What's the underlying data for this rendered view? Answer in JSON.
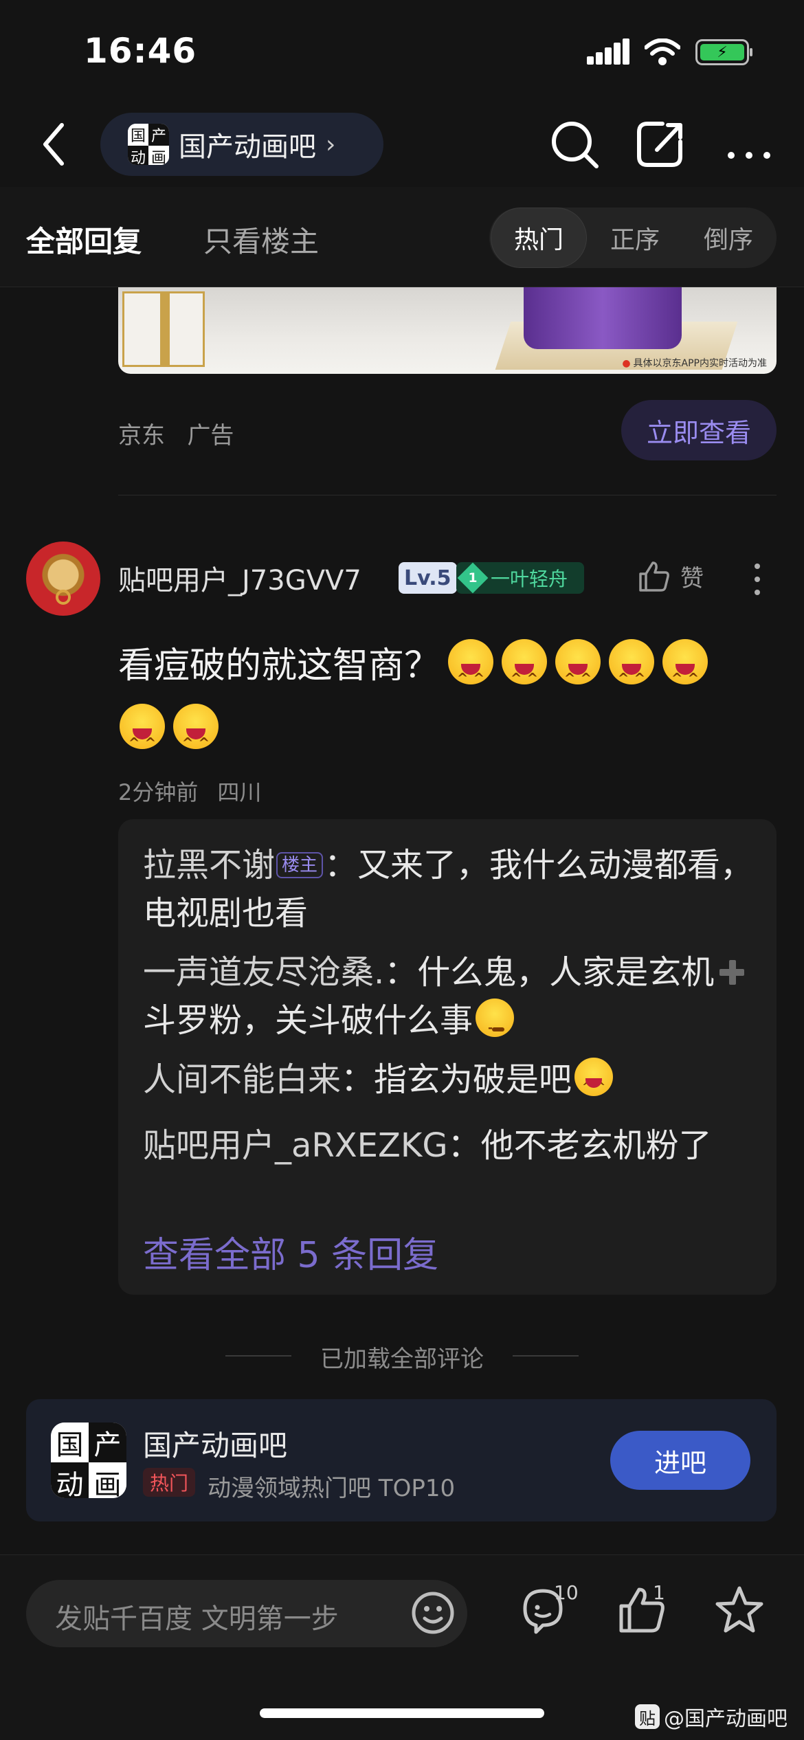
{
  "status": {
    "time": "16:46"
  },
  "nav": {
    "forum_name": "国产动画吧",
    "chevron": "›"
  },
  "forum_logo_chars": [
    "国",
    "产",
    "动",
    "画"
  ],
  "tabs": {
    "all_replies": "全部回复",
    "op_only": "只看楼主"
  },
  "sort": {
    "hot": "热门",
    "asc": "正序",
    "desc": "倒序",
    "selected": "热门"
  },
  "ad": {
    "note": "具体以京东APP内实时活动为准",
    "source": "京东",
    "label": "广告",
    "button": "立即查看"
  },
  "post": {
    "username": "贴吧用户_J73GVV7",
    "level": "Lv.5",
    "title_level": "1",
    "title_name": "一叶轻舟",
    "like_label": "赞",
    "text": "看痘破的就这智商？",
    "emoji_count": 7,
    "time": "2分钟前",
    "location": "四川"
  },
  "replies": [
    {
      "name": "拉黑不谢",
      "tag": "楼主",
      "sep": "：",
      "text": "又来了，我什么动漫都看，电视剧也看"
    },
    {
      "name": "一声道友尽沧桑.",
      "sep": "：",
      "text_before": "什么鬼，人家是玄机",
      "text_after": "斗罗粉，关斗破什么事"
    },
    {
      "name": "人间不能白来",
      "sep": "：",
      "text": "指玄为破是吧"
    },
    {
      "name": "贴吧用户_aRXEZKG",
      "sep": "：",
      "text": "他不老玄机粉了"
    }
  ],
  "view_all": "查看全部 5 条回复",
  "loaded_text": "已加载全部评论",
  "forum_card": {
    "name": "国产动画吧",
    "hot_tag": "热门",
    "desc": "动漫领域热门吧 TOP10",
    "join": "进吧"
  },
  "bottom": {
    "compose_placeholder": "发贴千百度 文明第一步",
    "comment_count": "10",
    "like_count": "1"
  },
  "watermark": {
    "icon": "贴",
    "text": "@国产动画吧"
  },
  "colors": {
    "accent_purple": "#9a8cf0",
    "join_blue": "#3b5ac7",
    "hot_red": "#f2555a",
    "battery_green": "#34c759"
  }
}
